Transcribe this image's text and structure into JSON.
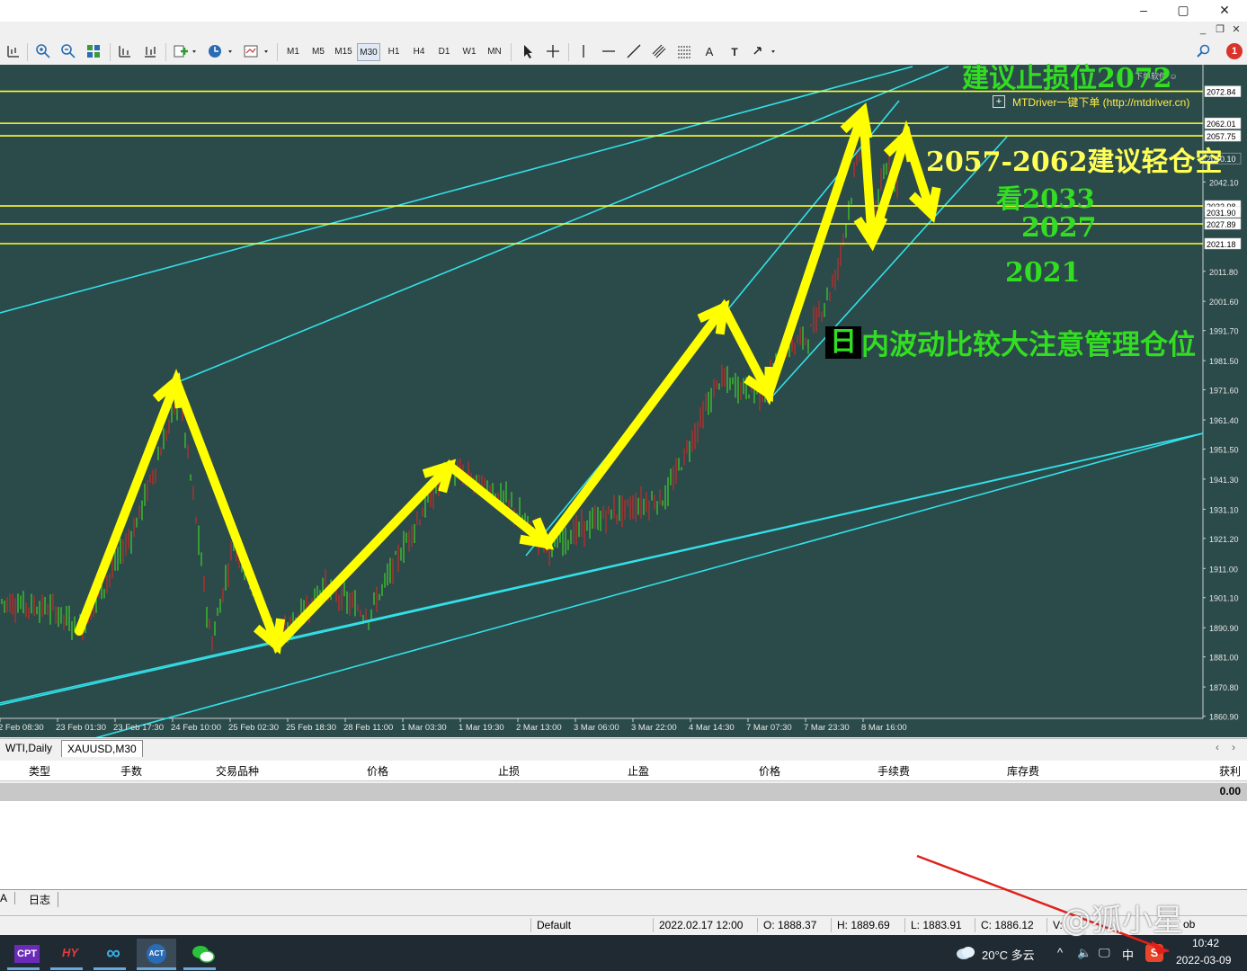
{
  "window": {
    "minimize": "–",
    "maximize": "▢",
    "close": "✕",
    "mdi_minimize": "_",
    "mdi_restore": "❐",
    "mdi_close": "✕"
  },
  "toolbar": {
    "timeframes": [
      "M1",
      "M5",
      "M15",
      "M30",
      "H1",
      "H4",
      "D1",
      "W1",
      "MN"
    ],
    "selected_timeframe": "M30",
    "text_tool": "A",
    "label_tool": "T",
    "notification_count": "1"
  },
  "chart": {
    "symbol": "XAUUSD,M30",
    "plugin_label": "MTDriver一键下单 (http://mtdriver.cn)",
    "plugin_corner": "下单软件 ☺",
    "plugin_expand": "+",
    "price_axis_labels": [
      "2042.10",
      "2011.80",
      "2001.60",
      "1991.70",
      "1981.50",
      "1971.60",
      "1961.40",
      "1951.50",
      "1941.30",
      "1931.10",
      "1921.20",
      "1911.00",
      "1901.10",
      "1890.90",
      "1881.00",
      "1870.80",
      "1860.90"
    ],
    "level_labels": [
      "2072.84",
      "2062.01",
      "2057.75",
      "2050.10",
      "2033.98",
      "2031.90",
      "2027.89",
      "2021.18"
    ],
    "time_axis_labels": [
      "2 Feb 08:30",
      "23 Feb 01:30",
      "23 Feb 17:30",
      "24 Feb 10:00",
      "25 Feb 02:30",
      "25 Feb 18:30",
      "28 Feb 11:00",
      "1 Mar 03:30",
      "1 Mar 19:30",
      "2 Mar 13:00",
      "3 Mar 06:00",
      "3 Mar 22:00",
      "4 Mar 14:30",
      "7 Mar 07:30",
      "7 Mar 23:30",
      "8 Mar 16:00"
    ],
    "annotations": {
      "stop_loss": "建议止损位2072",
      "short_zone": "2057-2062建议轻仓空",
      "target": "看2033",
      "level_2027": "2027",
      "level_2021": "2021",
      "day_box": "日",
      "risk_note": "内波动比较大注意管理仓位"
    },
    "colors": {
      "background": "#2b4a4a",
      "level_lines": "#ffff33",
      "trend_lines": "#33e0e8",
      "arrows": "#ffff00",
      "green_text": "#33dd22",
      "yellow_text": "#ffff55"
    }
  },
  "tabs": [
    "WTI,Daily",
    "XAUUSD,M30"
  ],
  "active_tab": "XAUUSD,M30",
  "terminal": {
    "columns": [
      "类型",
      "手数",
      "交易品种",
      "价格",
      "止损",
      "止盈",
      "价格",
      "手续费",
      "库存费",
      "获利"
    ],
    "balance_value": "0.00",
    "tabs": [
      "A",
      "日志"
    ]
  },
  "statusbar": {
    "profile": "Default",
    "datetime": "2022.02.17 12:00",
    "open": "O: 1888.37",
    "high": "H: 1889.69",
    "low": "L: 1883.91",
    "close": "C: 1886.12",
    "volume": "V:",
    "extra": "ob"
  },
  "taskbar": {
    "apps": [
      "CPT",
      "HY",
      "∞",
      "ACT",
      "微信"
    ],
    "weather": "20°C 多云",
    "ime": "中",
    "time": "10:42",
    "date": "2022-03-09"
  },
  "watermark": "@狐小星"
}
